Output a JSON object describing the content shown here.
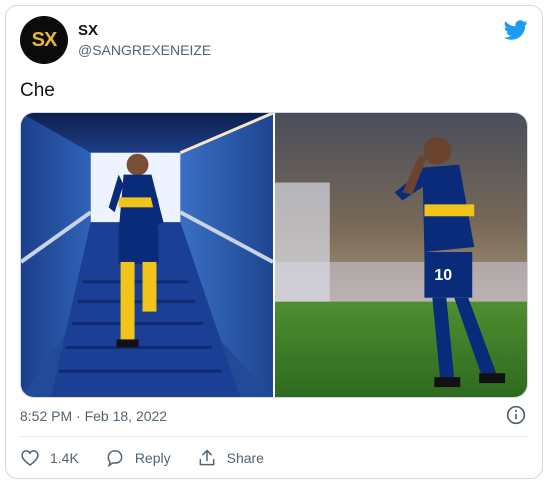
{
  "user": {
    "avatar_text": "SX",
    "name": "SX",
    "handle": "@SANGREXENEIZE"
  },
  "tweet": {
    "text": "Che",
    "timestamp": "8:52 PM · Feb 18, 2022"
  },
  "actions": {
    "likes": "1.4K",
    "reply_label": "Reply",
    "share_label": "Share"
  },
  "media": {
    "left_shirt_number": "",
    "right_shirt_number": "10"
  },
  "colors": {
    "twitter_blue": "#1d9bf0",
    "boca_blue": "#0a2a7a",
    "boca_yellow": "#f2c318"
  },
  "icons": [
    "twitter-bird-icon",
    "info-icon",
    "heart-icon",
    "reply-icon",
    "share-icon"
  ]
}
